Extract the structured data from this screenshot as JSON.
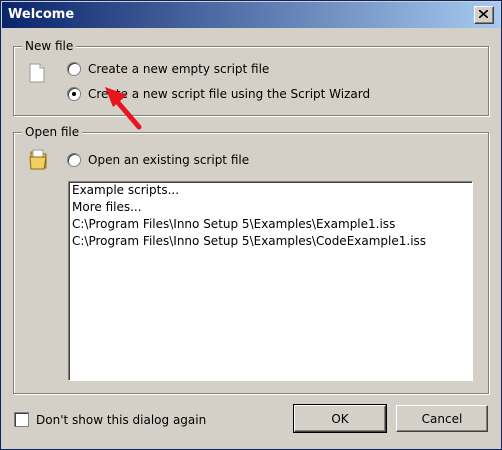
{
  "window": {
    "title": "Welcome"
  },
  "new_file": {
    "legend": "New file",
    "options": [
      {
        "label": "Create a new empty script file",
        "checked": false
      },
      {
        "label": "Create a new script file using the Script Wizard",
        "checked": true
      }
    ]
  },
  "open_file": {
    "legend": "Open file",
    "option_label": "Open an existing script file",
    "files": [
      "Example scripts...",
      "More files...",
      "C:\\Program Files\\Inno Setup 5\\Examples\\Example1.iss",
      "C:\\Program Files\\Inno Setup 5\\Examples\\CodeExample1.iss"
    ]
  },
  "footer": {
    "dont_show_label": "Don't show this dialog again",
    "ok_label": "OK",
    "cancel_label": "Cancel"
  },
  "colors": {
    "annotation_arrow": "#e8141e",
    "titlebar_start": "#0a246a",
    "titlebar_end": "#a6caf0"
  }
}
